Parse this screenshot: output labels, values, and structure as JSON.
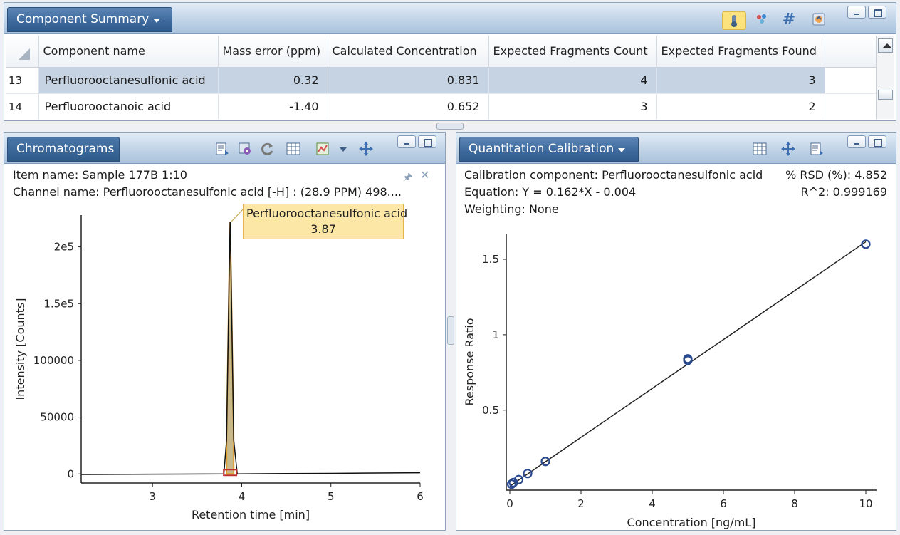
{
  "summary": {
    "title": "Component Summary",
    "columns": [
      "Component name",
      "Mass error (ppm)",
      "Calculated Concentration",
      "Expected Fragments Count",
      "Expected Fragments Found"
    ],
    "rows": [
      {
        "index": "13",
        "name": "Perfluorooctanesulfonic acid",
        "mass_error": "0.32",
        "calc_conc": "0.831",
        "frag_count": "4",
        "frag_found": "3"
      },
      {
        "index": "14",
        "name": "Perfluorooctanoic acid",
        "mass_error": "-1.40",
        "calc_conc": "0.652",
        "frag_count": "3",
        "frag_found": "2"
      }
    ]
  },
  "chromatograms": {
    "title": "Chromatograms",
    "item_name": "Item name: Sample 177B 1:10",
    "channel_name": "Channel name: Perfluorooctanesulfonic acid [-H] : (28.9 PPM) 498....",
    "peak_label": "Perfluorooctanesulfonic acid",
    "peak_rt": "3.87"
  },
  "calibration": {
    "title": "Quantitation Calibration",
    "component": "Calibration component: Perfluorooctanesulfonic acid",
    "equation": "Equation: Y = 0.162*X - 0.004",
    "weighting": "Weighting: None",
    "rsd": "% RSD (%): 4.852",
    "r2": "R^2: 0.999169"
  },
  "chart_data": [
    {
      "type": "line",
      "xlabel": "Retention time [min]",
      "ylabel": "Intensity [Counts]",
      "xlim": [
        2.2,
        6.0
      ],
      "ylim": [
        -8000,
        228000
      ],
      "xticks": [
        3,
        4,
        5,
        6
      ],
      "yticks": [
        0,
        50000,
        100000,
        150000,
        200000
      ],
      "ytick_labels": [
        "0",
        "50000",
        "100000",
        "1.5e5",
        "2e5"
      ],
      "series": [
        {
          "x": [
            2.2,
            3.0,
            3.8,
            3.83,
            3.86,
            3.87,
            3.88,
            3.91,
            3.95,
            4.5,
            5.0,
            6.0
          ],
          "y": [
            -500,
            -200,
            0,
            30000,
            180000,
            222000,
            180000,
            30000,
            0,
            300,
            500,
            1000
          ]
        }
      ],
      "integration": {
        "start": 3.83,
        "end": 3.91
      }
    },
    {
      "type": "scatter",
      "xlabel": "Concentration [ng/mL]",
      "ylabel": "Response Ratio",
      "xlim": [
        -0.1,
        10.3
      ],
      "ylim": [
        -0.03,
        1.67
      ],
      "xticks": [
        0,
        2,
        4,
        6,
        8,
        10
      ],
      "yticks": [
        0.5,
        1,
        1.5
      ],
      "ytick_labels": [
        "0.5",
        "1",
        "1.5"
      ],
      "points": {
        "x": [
          0.05,
          0.1,
          0.25,
          0.5,
          1,
          5,
          5,
          10
        ],
        "y": [
          0.01,
          0.02,
          0.04,
          0.08,
          0.16,
          0.83,
          0.84,
          1.6
        ]
      },
      "fit": {
        "slope": 0.162,
        "intercept": -0.004
      }
    }
  ]
}
